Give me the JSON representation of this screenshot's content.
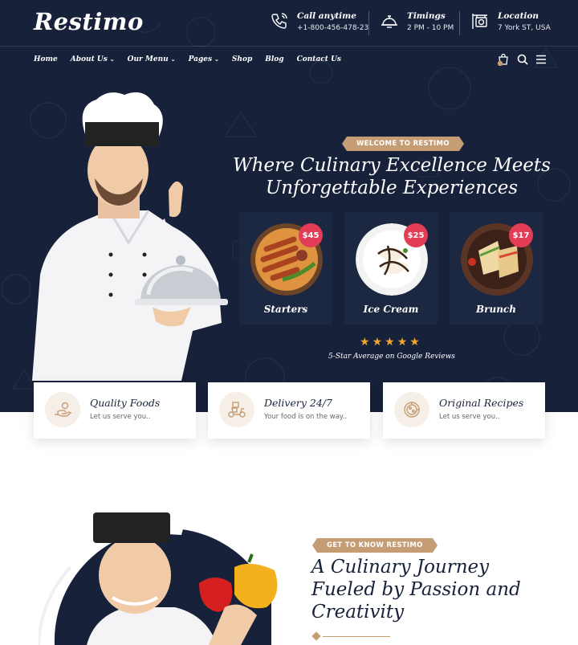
{
  "brand": {
    "logo": "Restimo"
  },
  "header": {
    "call": {
      "title": "Call anytime",
      "value": "+1-800-456-478-23",
      "icon": "phone-icon"
    },
    "timings": {
      "title": "Timings",
      "value": "2 PM - 10 PM",
      "icon": "bell-icon"
    },
    "location": {
      "title": "Location",
      "value": "7 York ST, USA",
      "icon": "signboard-icon"
    }
  },
  "nav": {
    "items": [
      {
        "label": "Home",
        "dropdown": false
      },
      {
        "label": "About Us",
        "dropdown": true
      },
      {
        "label": "Our Menu",
        "dropdown": true
      },
      {
        "label": "Pages",
        "dropdown": true
      },
      {
        "label": "Shop",
        "dropdown": false
      },
      {
        "label": "Blog",
        "dropdown": false
      },
      {
        "label": "Contact Us",
        "dropdown": false
      }
    ],
    "caret": "⌄"
  },
  "hero": {
    "badge": "WELCOME TO RESTIMO",
    "title_line1": "Where Culinary Excellence Meets",
    "title_line2": "Unforgettable Experiences",
    "dishes": [
      {
        "name": "Starters",
        "price": "$45"
      },
      {
        "name": "Ice Cream",
        "price": "$25"
      },
      {
        "name": "Brunch",
        "price": "$17"
      }
    ],
    "rating_stars": 5,
    "reviews_text": "5-Star Average on Google Reviews"
  },
  "features": [
    {
      "title": "Quality Foods",
      "subtitle": "Let us serve you..",
      "icon": "serving-hand-icon"
    },
    {
      "title": "Delivery 24/7",
      "subtitle": "Your food is on the way..",
      "icon": "scooter-icon"
    },
    {
      "title": "Original Recipes",
      "subtitle": "Let us serve you..",
      "icon": "pizza-icon"
    }
  ],
  "about": {
    "badge": "GET TO KNOW RESTIMO",
    "title_line1": "A Culinary Journey",
    "title_line2": "Fueled by Passion and",
    "title_line3": "Creativity"
  },
  "colors": {
    "navy": "#17213a",
    "accent": "#c59d74",
    "price": "#e33c57",
    "star": "#f0a630"
  }
}
